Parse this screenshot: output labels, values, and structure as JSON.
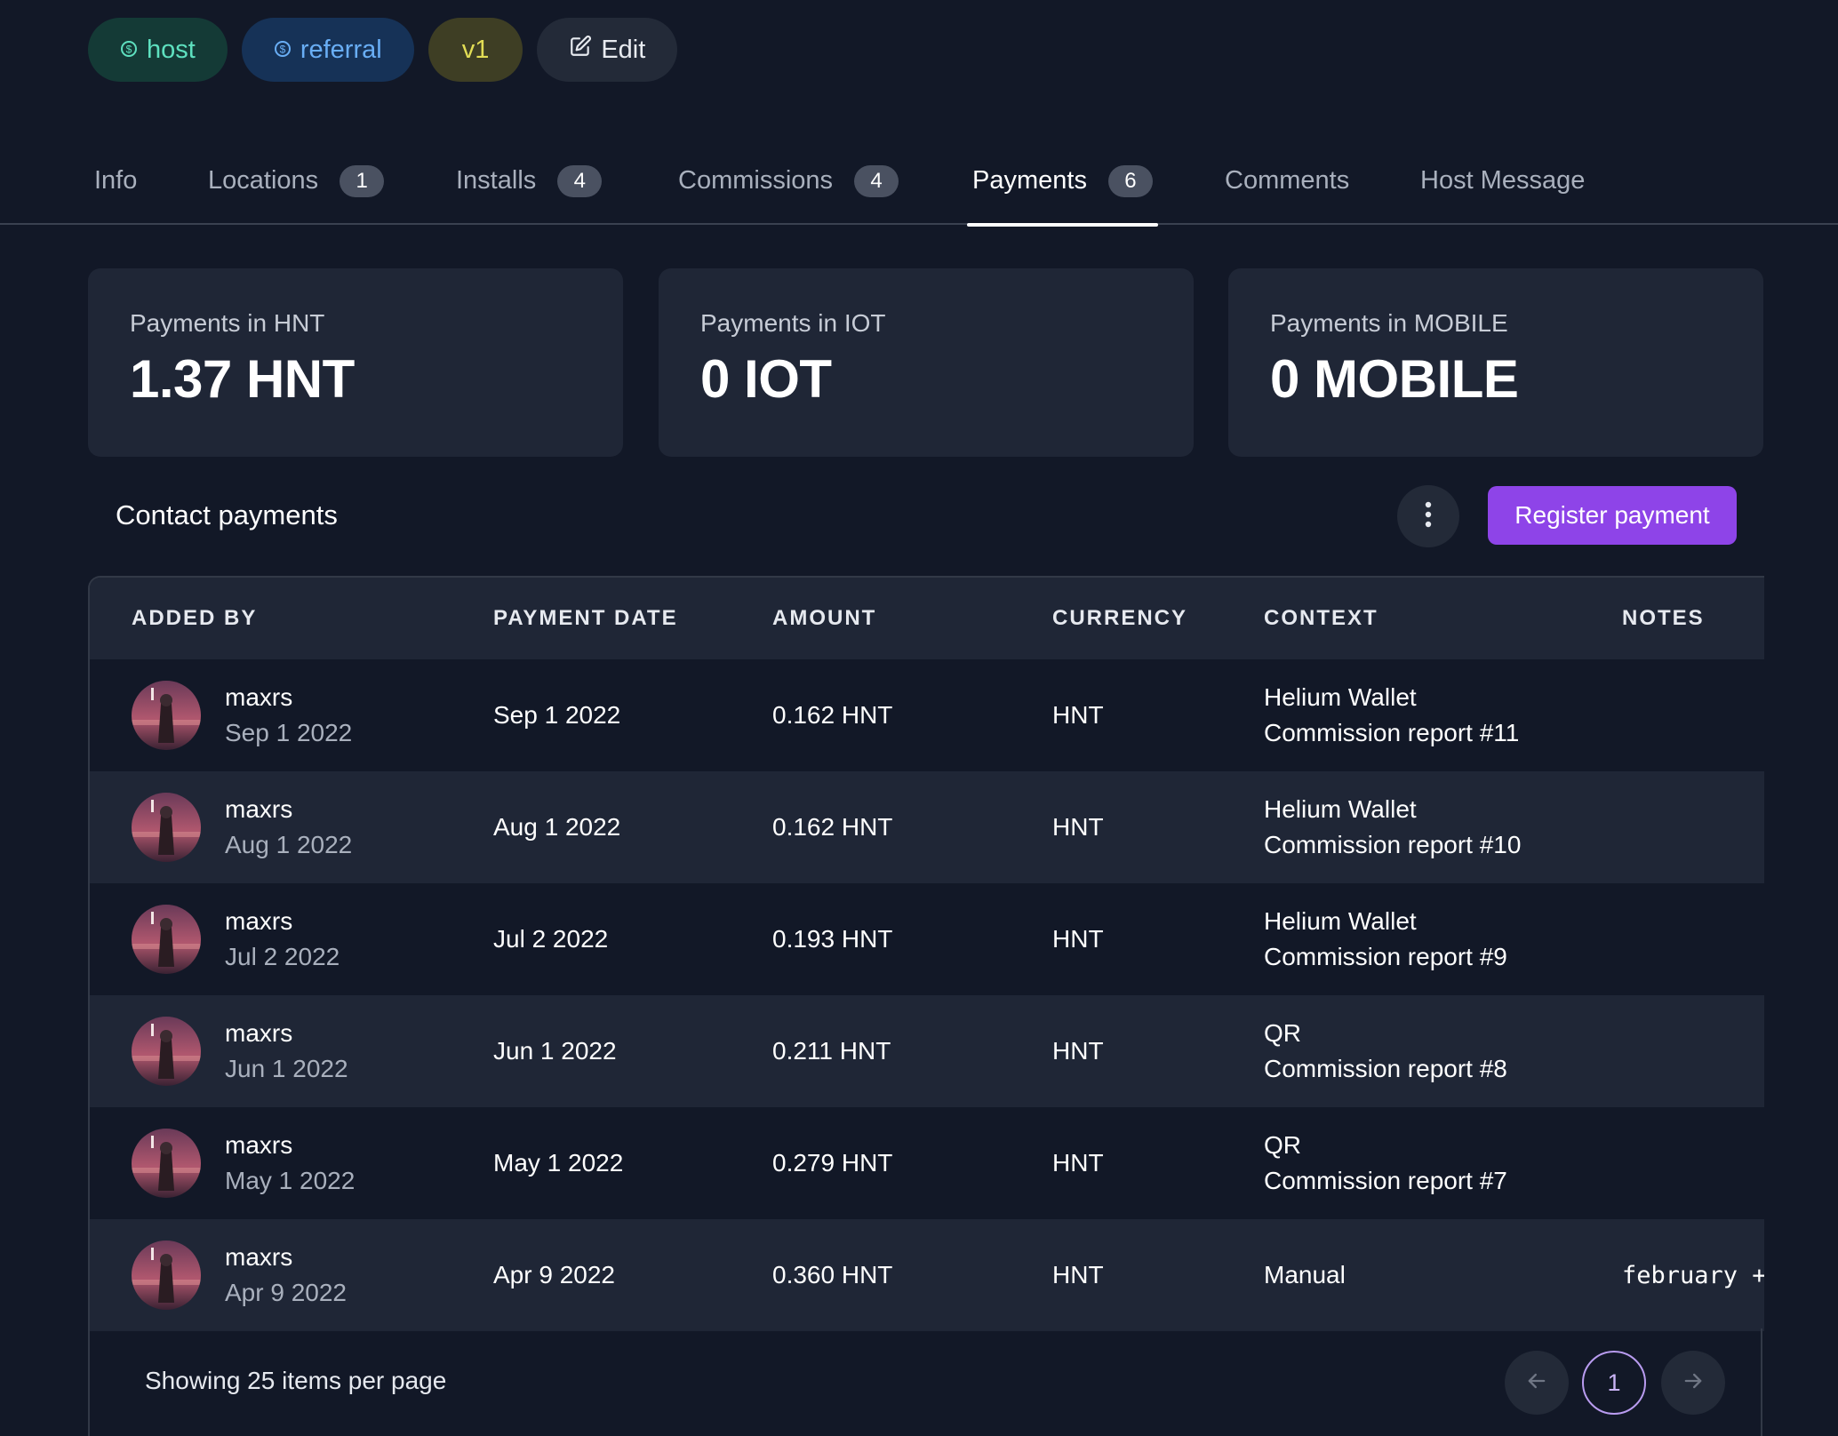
{
  "tags": {
    "host": "host",
    "referral": "referral",
    "version": "v1",
    "edit": "Edit"
  },
  "tabs": [
    {
      "label": "Info",
      "count": null
    },
    {
      "label": "Locations",
      "count": "1"
    },
    {
      "label": "Installs",
      "count": "4"
    },
    {
      "label": "Commissions",
      "count": "4"
    },
    {
      "label": "Payments",
      "count": "6",
      "active": true
    },
    {
      "label": "Comments",
      "count": null
    },
    {
      "label": "Host Message",
      "count": null
    }
  ],
  "stats": [
    {
      "label": "Payments in HNT",
      "value": "1.37 HNT"
    },
    {
      "label": "Payments in IOT",
      "value": "0 IOT"
    },
    {
      "label": "Payments in MOBILE",
      "value": "0 MOBILE"
    }
  ],
  "section": {
    "title": "Contact payments",
    "register_button": "Register payment"
  },
  "table": {
    "headers": [
      "ADDED BY",
      "PAYMENT DATE",
      "AMOUNT",
      "CURRENCY",
      "CONTEXT",
      "NOTES"
    ],
    "rows": [
      {
        "by": "maxrs",
        "by_date": "Sep 1 2022",
        "date": "Sep 1 2022",
        "amount": "0.162 HNT",
        "currency": "HNT",
        "context1": "Helium Wallet",
        "context2": "Commission report #11",
        "notes": ""
      },
      {
        "by": "maxrs",
        "by_date": "Aug 1 2022",
        "date": "Aug 1 2022",
        "amount": "0.162 HNT",
        "currency": "HNT",
        "context1": "Helium Wallet",
        "context2": "Commission report #10",
        "notes": ""
      },
      {
        "by": "maxrs",
        "by_date": "Jul 2 2022",
        "date": "Jul 2 2022",
        "amount": "0.193 HNT",
        "currency": "HNT",
        "context1": "Helium Wallet",
        "context2": "Commission report #9",
        "notes": ""
      },
      {
        "by": "maxrs",
        "by_date": "Jun 1 2022",
        "date": "Jun 1 2022",
        "amount": "0.211 HNT",
        "currency": "HNT",
        "context1": "QR",
        "context2": "Commission report #8",
        "notes": ""
      },
      {
        "by": "maxrs",
        "by_date": "May 1 2022",
        "date": "May 1 2022",
        "amount": "0.279 HNT",
        "currency": "HNT",
        "context1": "QR",
        "context2": "Commission report #7",
        "notes": ""
      },
      {
        "by": "maxrs",
        "by_date": "Apr 9 2022",
        "date": "Apr 9 2022",
        "amount": "0.360 HNT",
        "currency": "HNT",
        "context1": "Manual",
        "context2": "",
        "notes": "february +"
      }
    ]
  },
  "footer": {
    "items_text": "Showing 25 items per page",
    "current_page": "1"
  },
  "colors": {
    "background": "#121827",
    "card": "#1f2636",
    "accent": "#8e44e8",
    "host_pill": "#143a36",
    "referral_pill": "#163257",
    "version_pill": "#3e3e24"
  },
  "icons": {
    "tag": "dollar-coin-icon",
    "edit": "edit-icon",
    "kebab": "more-vertical-icon",
    "prev": "arrow-left-icon",
    "next": "arrow-right-icon"
  }
}
